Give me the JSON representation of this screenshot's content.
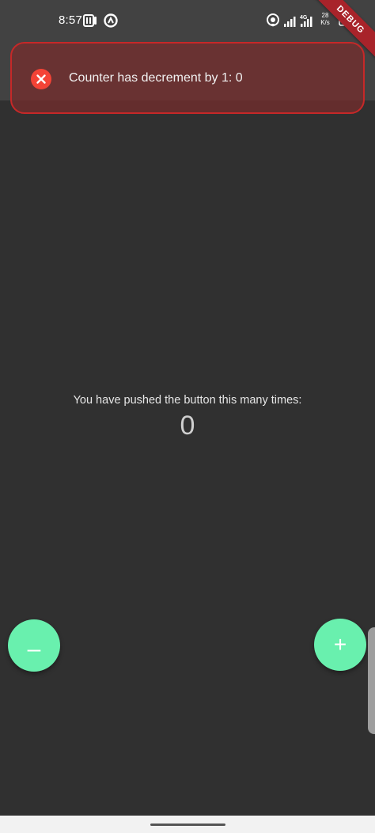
{
  "status_bar": {
    "time": "8:57",
    "network_speed": "28",
    "network_speed_unit": "K/s",
    "network_type": "4G",
    "icons": [
      "pocket-icon",
      "signal-app-icon",
      "hotspot-icon",
      "signal-bars-icon",
      "wifi-icon",
      "battery-charging-icon"
    ]
  },
  "debug_banner": {
    "label": "DEBUG"
  },
  "toast": {
    "icon": "error-close-icon",
    "message": "Counter has decrement by 1: 0"
  },
  "main": {
    "label": "You have pushed the button this many times:",
    "counter": "0"
  },
  "fabs": {
    "decrement_label": "–",
    "increment_label": "+"
  },
  "colors": {
    "background": "#303030",
    "appbar": "#424242",
    "toast_border": "#c62828",
    "toast_bg": "#782d2d",
    "error_icon": "#f44336",
    "fab": "#69f0ae",
    "debug_banner": "#a8232a"
  }
}
